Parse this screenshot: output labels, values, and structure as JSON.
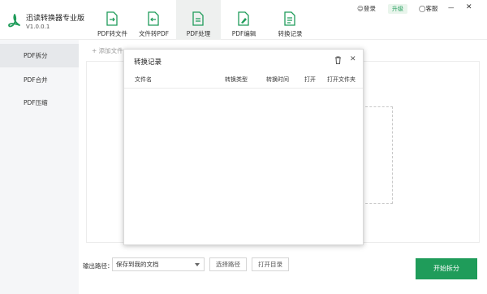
{
  "app": {
    "name": "迅读转换器专业版",
    "version": "V1.0.0.1"
  },
  "nav": {
    "tabs": [
      {
        "label": "PDF转文件",
        "icon": "pdf-to-file-icon"
      },
      {
        "label": "文件转PDF",
        "icon": "file-to-pdf-icon"
      },
      {
        "label": "PDF处理",
        "icon": "pdf-process-icon"
      },
      {
        "label": "PDF编辑",
        "icon": "pdf-edit-icon"
      },
      {
        "label": "转换记录",
        "icon": "convert-record-icon"
      }
    ],
    "active_tab": "PDF处理"
  },
  "top_right": {
    "login": "登录",
    "upgrade": "升级",
    "support": "客服"
  },
  "sidebar": {
    "items": [
      {
        "label": "PDF拆分"
      },
      {
        "label": "PDF合并"
      },
      {
        "label": "PDF压缩"
      }
    ],
    "active": "PDF拆分"
  },
  "main": {
    "add_file": "+ 添加文件"
  },
  "bottom": {
    "output_label": "输出路径：",
    "output_value": "保存到我的文档",
    "choose_path": "选择路径",
    "open_dir": "打开目录",
    "start": "开始拆分"
  },
  "dialog": {
    "title": "转换记录",
    "columns": [
      "文件名",
      "转换类型",
      "转换时间",
      "打开",
      "打开文件夹"
    ]
  },
  "colors": {
    "accent": "#1f9c5a",
    "sidebar_bg": "#f5f6f8"
  }
}
